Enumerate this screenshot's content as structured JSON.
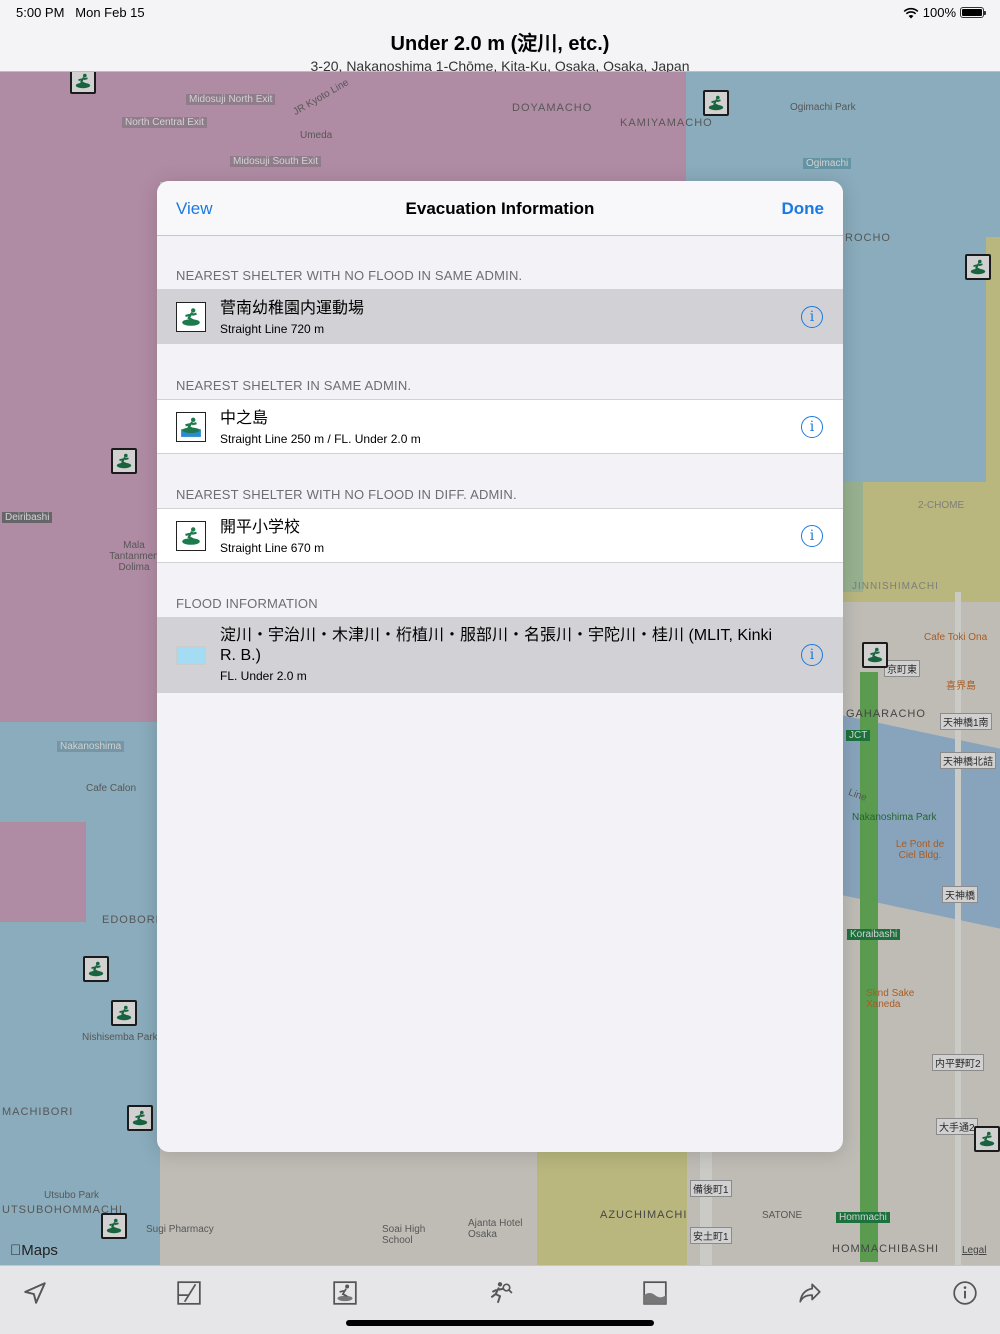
{
  "status_bar": {
    "time": "5:00 PM",
    "date": "Mon Feb 15",
    "battery": "100%"
  },
  "header": {
    "title": "Under 2.0 m (淀川, etc.)",
    "subtitle": "3-20, Nakanoshima 1-Chōme, Kita-Ku, Osaka, Osaka, Japan"
  },
  "map": {
    "labels": [
      "Midosuji North Exit",
      "JR Kyoto Line",
      "North Central Exit",
      "Umeda",
      "Midosuji South Exit",
      "DOYAMACHO",
      "KAMIYAMACHO",
      "Ogimachi Park",
      "Ogimachi",
      "ROCHO",
      "Deiribashi",
      "Mala Tantanmen Dolima",
      "Nakanoshima",
      "Cafe Calon",
      "EDOBORI",
      "Nishisemba Park",
      "MACHIBORI",
      "Utsubo Park",
      "UTSUBOHOMMACHI",
      "Sugi Pharmacy",
      "Soai High School",
      "Ajanta Hotel Osaka",
      "AZUCHIMACHI",
      "SATONE",
      "Hommachi",
      "HOMMACHIBASHI",
      "Cafe Toki Ona",
      "GAHARACHO",
      "Nakanoshima Park",
      "Le Pont de Ciel Bldg.",
      "Koraibashi",
      "Sknd Sake Xaneda",
      "2-CHOME",
      "JINNISHIMACHI",
      "JCT",
      "Line",
      "天神橋1南",
      "天神橋北詰",
      "天神橋",
      "内平野町2",
      "大手通2",
      "備後町1",
      "安土町1",
      "喜界島",
      "京町東"
    ],
    "logo": "Maps",
    "legal": "Legal"
  },
  "modal": {
    "nav": {
      "left_label": "View",
      "title": "Evacuation Information",
      "right_label": "Done"
    },
    "sections": [
      {
        "header": "NEAREST SHELTER WITH NO FLOOD IN SAME ADMIN.",
        "title": "菅南幼稚園内運動場",
        "detail": "Straight Line 720 m",
        "icon": "evacuation-shelter-icon"
      },
      {
        "header": "NEAREST SHELTER IN SAME ADMIN.",
        "title": "中之島",
        "detail": "Straight Line 250 m / FL. Under 2.0 m",
        "icon": "flooded-shelter-icon"
      },
      {
        "header": "NEAREST SHELTER WITH NO FLOOD IN DIFF. ADMIN.",
        "title": "開平小学校",
        "detail": "Straight Line 670 m",
        "icon": "evacuation-shelter-icon"
      },
      {
        "header": "FLOOD INFORMATION",
        "title": "淀川・宇治川・木津川・桁植川・服部川・名張川・宇陀川・桂川 (MLIT, Kinki R. B.)",
        "detail": "FL. Under 2.0 m",
        "swatch_color": "#a4dcf4"
      }
    ],
    "info_glyph": "i"
  },
  "toolbar": {
    "icons": [
      "location-arrow-icon",
      "map-style-icon",
      "shelter-icon",
      "evacuation-run-icon",
      "flood-layer-icon",
      "share-icon",
      "info-icon"
    ]
  },
  "colors": {
    "accent": "#1a7ae0",
    "flood_pink": "#d9a9c9",
    "flood_blue": "#a9d4ea",
    "flood_yellow": "#e3e39c",
    "shelter_green": "#1d7a4c"
  }
}
